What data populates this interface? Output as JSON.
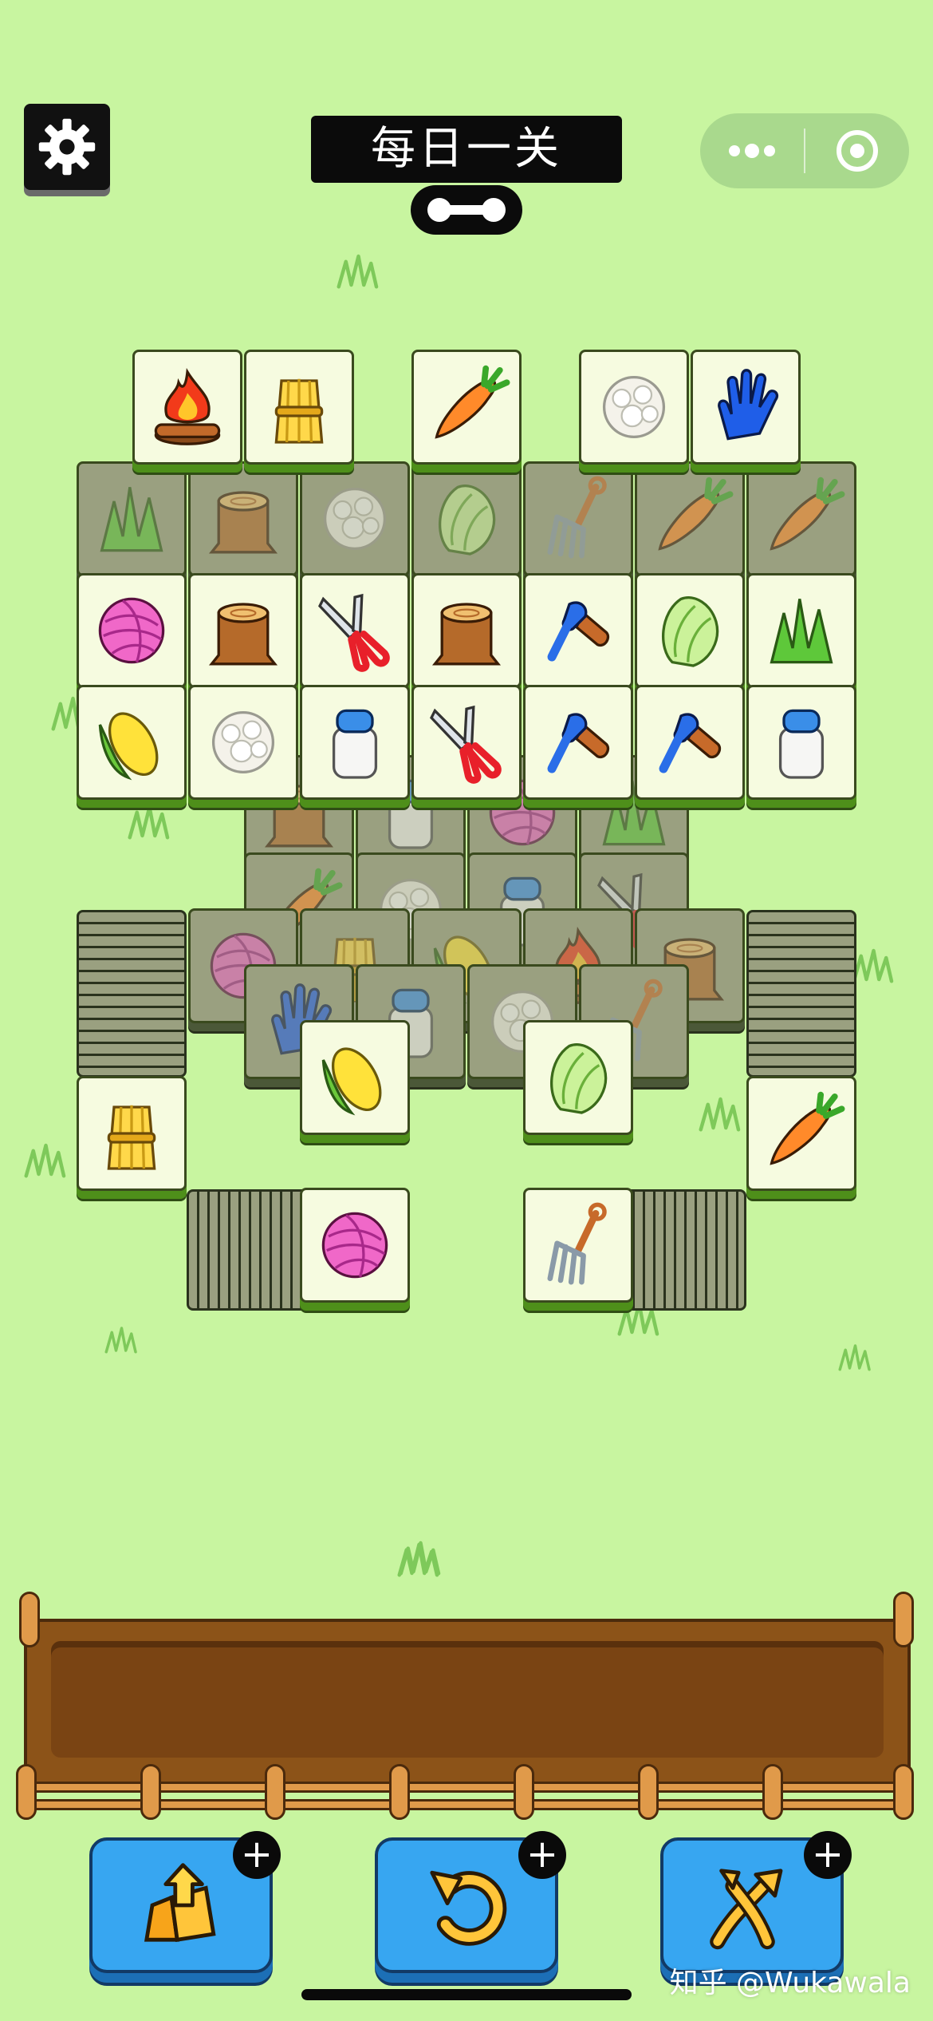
{
  "header": {
    "title": "每日一关",
    "settings_icon": "gear-icon",
    "menu_icon": "more-dots-icon",
    "close_icon": "target-circle-icon"
  },
  "colors": {
    "background": "#c8f5a0",
    "tile_face": "#f6fbe0",
    "tile_covered": "#9aa080",
    "button_blue": "#37a6f1",
    "tray_brown": "#8c5318"
  },
  "tiles": {
    "top_row": [
      "campfire-icon",
      "wheat-icon",
      "carrot-icon",
      "cotton-icon",
      "glove-icon"
    ],
    "row_1": [
      "yarn-icon",
      "stump-icon",
      "scissors-icon",
      "stump-icon",
      "brush-icon",
      "cabbage-icon",
      "grass-icon"
    ],
    "row_2": [
      "corn-icon",
      "cotton-icon",
      "milk-icon",
      "scissors-icon",
      "brush-icon",
      "brush-icon",
      "milk-icon"
    ],
    "lower_open": [
      "corn-icon",
      "cabbage-icon",
      "wheat-icon",
      "carrot-icon",
      "yarn-icon",
      "pitchfork-icon"
    ]
  },
  "tools": [
    {
      "name": "move-out",
      "icon": "pop-out-icon",
      "badge": "+"
    },
    {
      "name": "undo",
      "icon": "undo-icon",
      "badge": "+"
    },
    {
      "name": "shuffle",
      "icon": "shuffle-icon",
      "badge": "+"
    }
  ],
  "watermark": "知乎 @Wukawala"
}
